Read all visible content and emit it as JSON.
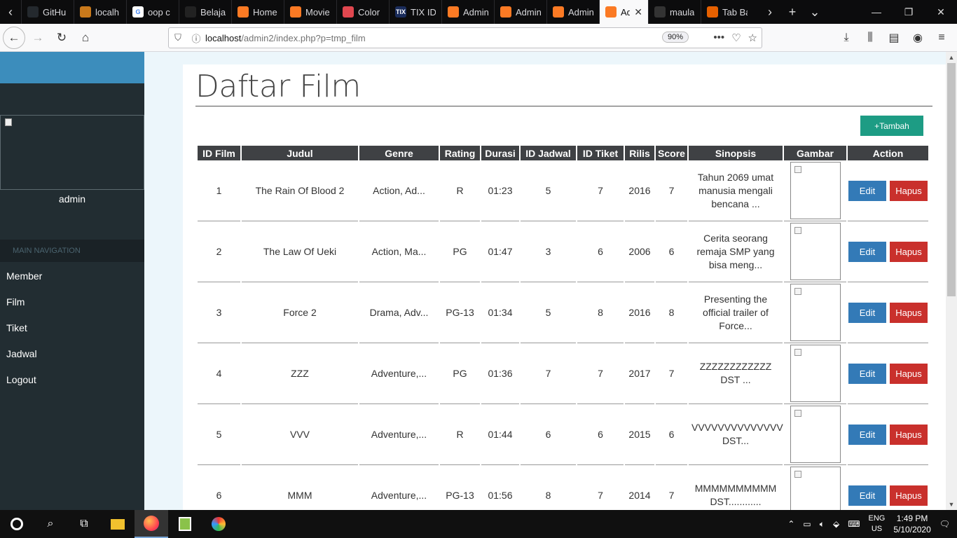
{
  "browser": {
    "tabs": [
      {
        "label": "GitHu",
        "fav_color": "#24292e",
        "fav_glyph": "",
        "active": false
      },
      {
        "label": "localh",
        "fav_color": "#c9791b",
        "fav_glyph": "",
        "active": false
      },
      {
        "label": "oop c",
        "fav_color": "#ffffff",
        "fav_glyph": "G",
        "active": false
      },
      {
        "label": "Belaja",
        "fav_color": "#222222",
        "fav_glyph": "",
        "active": false
      },
      {
        "label": "Home",
        "fav_color": "#fb7a24",
        "fav_glyph": "",
        "active": false
      },
      {
        "label": "Movie",
        "fav_color": "#fb7a24",
        "fav_glyph": "",
        "active": false
      },
      {
        "label": "Color",
        "fav_color": "#e0474f",
        "fav_glyph": "",
        "active": false
      },
      {
        "label": "TIX ID",
        "fav_color": "#1a2c5b",
        "fav_glyph": "TIX",
        "active": false
      },
      {
        "label": "Admin",
        "fav_color": "#fb7a24",
        "fav_glyph": "",
        "active": false
      },
      {
        "label": "Admin",
        "fav_color": "#fb7a24",
        "fav_glyph": "",
        "active": false
      },
      {
        "label": "Admin",
        "fav_color": "#fb7a24",
        "fav_glyph": "",
        "active": false
      },
      {
        "label": "Ad",
        "fav_color": "#fb7a24",
        "fav_glyph": "",
        "active": true
      },
      {
        "label": "maula",
        "fav_color": "#333333",
        "fav_glyph": "",
        "active": false
      },
      {
        "label": "Tab Ba",
        "fav_color": "#e66000",
        "fav_glyph": "",
        "active": false
      }
    ],
    "url_host": "localhost",
    "url_path": "/admin2/index.php?p=tmp_film",
    "zoom": "90%"
  },
  "sidebar": {
    "username": "admin",
    "section_label": "MAIN NAVIGATION",
    "items": [
      "Member",
      "Film",
      "Tiket",
      "Jadwal",
      "Logout"
    ]
  },
  "main": {
    "title": "Daftar Film",
    "add_button": "+Tambah",
    "columns": [
      "ID Film",
      "Judul",
      "Genre",
      "Rating",
      "Durasi",
      "ID Jadwal",
      "ID Tiket",
      "Rilis",
      "Score",
      "Sinopsis",
      "Gambar",
      "Action"
    ],
    "edit_label": "Edit",
    "delete_label": "Hapus",
    "rows": [
      {
        "id": "1",
        "judul": "The Rain Of Blood 2",
        "genre": "Action, Ad...",
        "rating": "R",
        "durasi": "01:23",
        "id_jadwal": "5",
        "id_tiket": "7",
        "rilis": "2016",
        "score": "7",
        "sinopsis": "Tahun 2069 umat manusia mengali bencana ..."
      },
      {
        "id": "2",
        "judul": "The Law Of Ueki",
        "genre": "Action, Ma...",
        "rating": "PG",
        "durasi": "01:47",
        "id_jadwal": "3",
        "id_tiket": "6",
        "rilis": "2006",
        "score": "6",
        "sinopsis": "Cerita seorang remaja SMP yang bisa meng..."
      },
      {
        "id": "3",
        "judul": "Force 2",
        "genre": "Drama, Adv...",
        "rating": "PG-13",
        "durasi": "01:34",
        "id_jadwal": "5",
        "id_tiket": "8",
        "rilis": "2016",
        "score": "8",
        "sinopsis": "Presenting the official trailer of Force..."
      },
      {
        "id": "4",
        "judul": "ZZZ",
        "genre": "Adventure,...",
        "rating": "PG",
        "durasi": "01:36",
        "id_jadwal": "7",
        "id_tiket": "7",
        "rilis": "2017",
        "score": "7",
        "sinopsis": "ZZZZZZZZZZZZ DST ..."
      },
      {
        "id": "5",
        "judul": "VVV",
        "genre": "Adventure,...",
        "rating": "R",
        "durasi": "01:44",
        "id_jadwal": "6",
        "id_tiket": "6",
        "rilis": "2015",
        "score": "6",
        "sinopsis": "VVVVVVVVVVVVVV DST..."
      },
      {
        "id": "6",
        "judul": "MMM",
        "genre": "Adventure,...",
        "rating": "PG-13",
        "durasi": "01:56",
        "id_jadwal": "8",
        "id_tiket": "7",
        "rilis": "2014",
        "score": "7",
        "sinopsis": "MMMMMMMMMM DST............"
      }
    ]
  },
  "taskbar": {
    "lang_top": "ENG",
    "lang_bottom": "US",
    "time": "1:49 PM",
    "date": "5/10/2020"
  },
  "colors": {
    "sidebar_bg": "#222d32",
    "sidebar_header": "#3c8dbc",
    "add_button": "#1d9c84",
    "edit_button": "#337ab7",
    "delete_button": "#c9302c"
  }
}
